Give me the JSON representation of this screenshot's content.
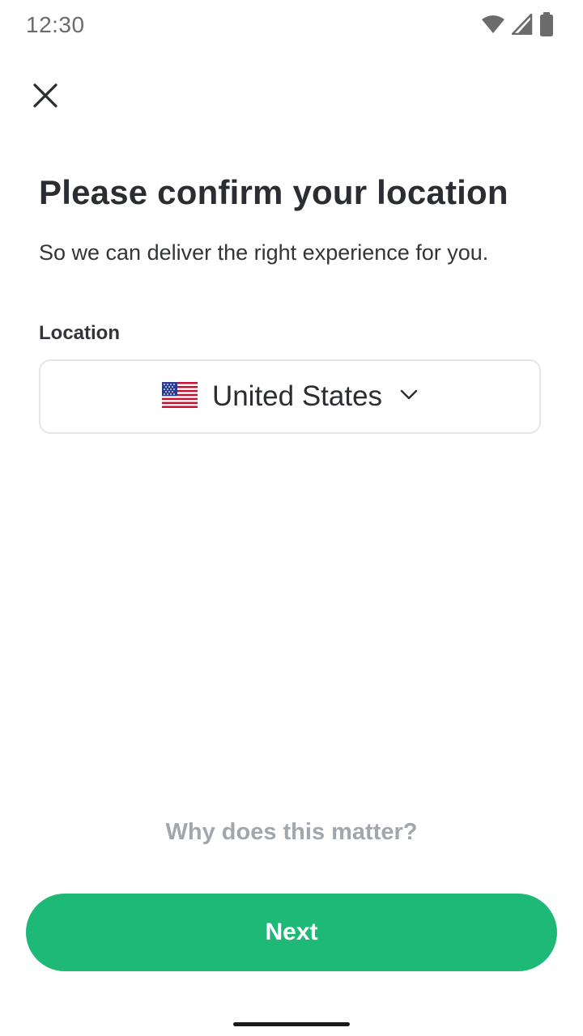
{
  "status_bar": {
    "time": "12:30",
    "icons": [
      "wifi-icon",
      "cellular-signal-icon",
      "battery-icon"
    ]
  },
  "header": {
    "close_icon": "close-icon"
  },
  "main": {
    "title": "Please confirm your location",
    "subtitle": "So we can deliver the right experience for you.",
    "location_label": "Location",
    "location_select": {
      "flag_icon": "us-flag-icon",
      "value": "United States",
      "chevron_icon": "chevron-down-icon"
    },
    "why_link": "Why does this matter?",
    "next_label": "Next"
  },
  "colors": {
    "primary": "#1eb977",
    "text": "#2b2d33",
    "muted": "#a2a7ad",
    "border": "#e5e6e8"
  }
}
